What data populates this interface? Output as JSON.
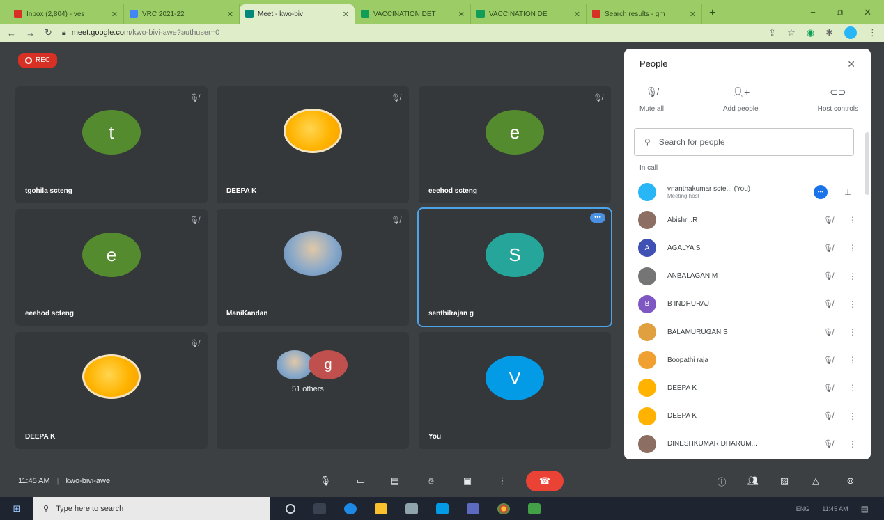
{
  "browser": {
    "tabs": [
      {
        "title": "Inbox (2,804) - ves",
        "color": "#d93025"
      },
      {
        "title": "VRC 2021-22",
        "color": "#4285f4"
      },
      {
        "title": "Meet - kwo-biv",
        "color": "#00897b",
        "active": true
      },
      {
        "title": "VACCINATION DET",
        "color": "#0f9d58"
      },
      {
        "title": "VACCINATION DE",
        "color": "#0f9d58"
      },
      {
        "title": "Search results - gm",
        "color": "#d93025"
      }
    ],
    "new_tab": "+",
    "url_host": "meet.google.com",
    "url_path": "/kwo-bivi-awe?authuser=0",
    "win_minimize": "−",
    "win_restore": "⧉",
    "win_close": "✕"
  },
  "meet": {
    "rec_label": "REC",
    "meeting_time": "11:45 AM",
    "meeting_code": "kwo-bivi-awe",
    "tiles": [
      {
        "name": "tgohila scteng",
        "initial": "t",
        "color": "#558b2f",
        "type": "letter",
        "muted": true
      },
      {
        "name": "DEEPA K",
        "initial": "",
        "color": "",
        "type": "orange",
        "muted": true
      },
      {
        "name": "eeehod scteng",
        "initial": "e",
        "color": "#558b2f",
        "type": "letter",
        "muted": true
      },
      {
        "name": "eeehod scteng",
        "initial": "e",
        "color": "#558b2f",
        "type": "letter",
        "muted": true
      },
      {
        "name": "ManiKandan",
        "initial": "",
        "color": "",
        "type": "photo",
        "muted": true
      },
      {
        "name": "senthilrajan g",
        "initial": "S",
        "color": "#26a69a",
        "type": "letter",
        "muted": false,
        "selected": true
      },
      {
        "name": "DEEPA K",
        "initial": "",
        "color": "",
        "type": "orange",
        "muted": true
      },
      {
        "name": "",
        "initial": "g",
        "color": "#c0504d",
        "type": "others",
        "muted": false,
        "others_label": "51 others"
      },
      {
        "name": "You",
        "initial": "V",
        "color": "#039be5",
        "type": "letter",
        "muted": false
      }
    ]
  },
  "people_panel": {
    "title": "People",
    "actions": [
      {
        "label": "Mute all",
        "icon": "mic-off-icon"
      },
      {
        "label": "Add people",
        "icon": "add-person-icon"
      },
      {
        "label": "Host controls",
        "icon": "toggle-icon"
      }
    ],
    "search_placeholder": "Search for people",
    "in_call_label": "In call",
    "people": [
      {
        "name": "vnanthakumar scte... (You)",
        "sub": "Meeting host",
        "avatar_color": "#29b6f6",
        "initial": ""
      },
      {
        "name": "Abishri .R",
        "sub": "",
        "avatar_color": "#8d6e63",
        "initial": ""
      },
      {
        "name": "AGALYA S",
        "sub": "",
        "avatar_color": "#3f51b5",
        "initial": "A"
      },
      {
        "name": "ANBALAGAN M",
        "sub": "",
        "avatar_color": "#757575",
        "initial": ""
      },
      {
        "name": "B INDHURAJ",
        "sub": "",
        "avatar_color": "#7e57c2",
        "initial": "B"
      },
      {
        "name": "BALAMURUGAN S",
        "sub": "",
        "avatar_color": "#e0a040",
        "initial": ""
      },
      {
        "name": "Boopathi raja",
        "sub": "",
        "avatar_color": "#f0a030",
        "initial": ""
      },
      {
        "name": "DEEPA K",
        "sub": "",
        "avatar_color": "#ffb300",
        "initial": ""
      },
      {
        "name": "DEEPA K",
        "sub": "",
        "avatar_color": "#ffb300",
        "initial": ""
      },
      {
        "name": "DINESHKUMAR DHARUM...",
        "sub": "",
        "avatar_color": "#8d6e63",
        "initial": ""
      }
    ]
  },
  "taskbar": {
    "search_placeholder": "Type here to search",
    "tray_lang": "ENG",
    "tray_time": "11:45 AM"
  }
}
